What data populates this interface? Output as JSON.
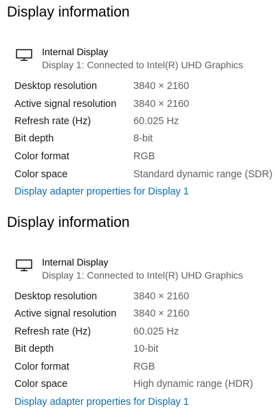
{
  "sections": [
    {
      "heading": "Display information",
      "display_name": "Internal Display",
      "display_subtitle": "Display 1: Connected to Intel(R) UHD Graphics",
      "monitor_icon": "monitor-icon",
      "rows": [
        {
          "label": "Desktop resolution",
          "value": "3840 × 2160"
        },
        {
          "label": "Active signal resolution",
          "value": "3840 × 2160"
        },
        {
          "label": "Refresh rate (Hz)",
          "value": "60.025 Hz"
        },
        {
          "label": "Bit depth",
          "value": "8-bit"
        },
        {
          "label": "Color format",
          "value": "RGB"
        },
        {
          "label": "Color space",
          "value": "Standard dynamic range (SDR)"
        }
      ],
      "link_label": "Display adapter properties for Display 1"
    },
    {
      "heading": "Display information",
      "display_name": "Internal Display",
      "display_subtitle": "Display 1: Connected to Intel(R) UHD Graphics",
      "monitor_icon": "monitor-icon",
      "rows": [
        {
          "label": "Desktop resolution",
          "value": "3840 × 2160"
        },
        {
          "label": "Active signal resolution",
          "value": "3840 × 2160"
        },
        {
          "label": "Refresh rate (Hz)",
          "value": "60.025 Hz"
        },
        {
          "label": "Bit depth",
          "value": "10-bit"
        },
        {
          "label": "Color format",
          "value": "RGB"
        },
        {
          "label": "Color space",
          "value": "High dynamic range (HDR)"
        }
      ],
      "link_label": "Display adapter properties for Display 1"
    }
  ],
  "colors": {
    "link": "#0a6cb8",
    "value_text": "#606060",
    "subtitle_text": "#5f5f5f"
  }
}
